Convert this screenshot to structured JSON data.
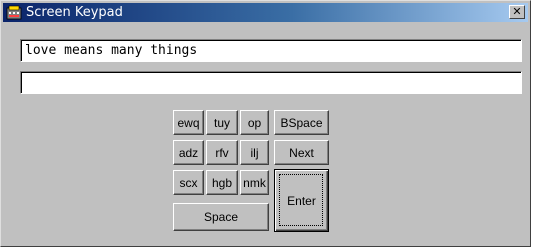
{
  "window": {
    "title": "Screen Keypad",
    "close_label": "✕"
  },
  "fields": {
    "input_value": "love means many things",
    "output_value": ""
  },
  "keys": {
    "ewq": "ewq",
    "tuy": "tuy",
    "op": "op",
    "bspace": "BSpace",
    "adz": "adz",
    "rfv": "rfv",
    "ilj": "ilj",
    "next": "Next",
    "scx": "scx",
    "hgb": "hgb",
    "nmk": "nmk",
    "enter": "Enter",
    "space": "Space"
  },
  "icons": {
    "app": "keypad-app-icon",
    "close": "close-icon"
  }
}
